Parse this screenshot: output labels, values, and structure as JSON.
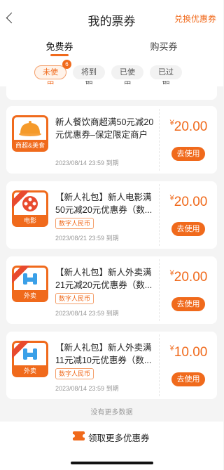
{
  "header": {
    "title": "我的票券",
    "exchange_label": "兑换优惠券"
  },
  "tabs": [
    {
      "label": "免费券",
      "active": true
    },
    {
      "label": "购买券",
      "active": false
    }
  ],
  "filters": [
    {
      "label": "未使用",
      "badge": "6",
      "active": true
    },
    {
      "label": "将到期",
      "active": false
    },
    {
      "label": "已使用",
      "active": false
    },
    {
      "label": "已过期",
      "active": false
    }
  ],
  "coupons": [
    {
      "title": "新人餐饮商超满50元减20元优惠券–保定限定商户",
      "thumb_label": "商超&美食",
      "thumb_icon": "food-dome-icon",
      "tag": "",
      "date": "2023/08/14 23:59 到期",
      "currency": "¥",
      "amount": "20.00",
      "button": "去使用"
    },
    {
      "title": "【新人礼包】新人电影满50元减20元优惠券（数...",
      "thumb_label": "电影",
      "thumb_icon": "film-reel-icon",
      "tag": "数字人民币",
      "date": "2023/08/21 23:59 到期",
      "currency": "¥",
      "amount": "20.00",
      "button": "去使用"
    },
    {
      "title": "【新人礼包】新人外卖满21元减20元优惠券（数...",
      "thumb_label": "外卖",
      "thumb_icon": "delivery-icon",
      "tag": "数字人民币",
      "date": "2023/08/14 23:59 到期",
      "currency": "¥",
      "amount": "20.00",
      "button": "去使用"
    },
    {
      "title": "【新人礼包】新人外卖满11元减10元优惠券（数...",
      "thumb_label": "外卖",
      "thumb_icon": "delivery-icon",
      "tag": "数字人民币",
      "date": "2023/08/14 23:59 到期",
      "currency": "¥",
      "amount": "10.00",
      "button": "去使用"
    }
  ],
  "no_more_text": "没有更多数据",
  "bottom": {
    "more_label": "领取更多优惠券",
    "icon": "coupon-icon"
  },
  "colors": {
    "accent": "#f06a1c",
    "background": "#f4f4f4"
  }
}
